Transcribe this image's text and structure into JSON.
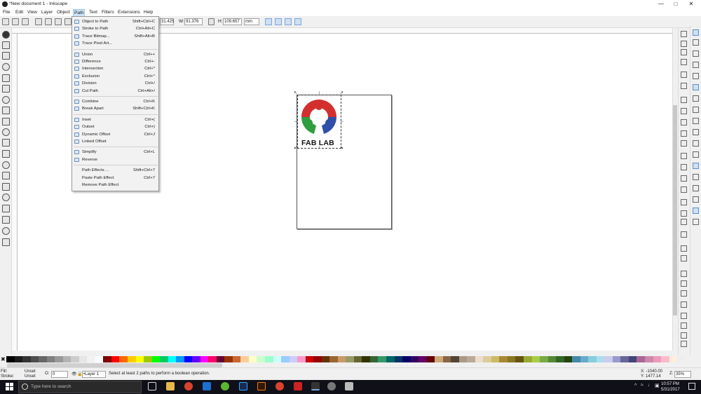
{
  "window": {
    "title": "*New document 1 - Inkscape"
  },
  "menubar": [
    "File",
    "Edit",
    "View",
    "Layer",
    "Object",
    "Path",
    "Text",
    "Filters",
    "Extensions",
    "Help"
  ],
  "toolbar": {
    "x_value": "31.425",
    "w_label": "W:",
    "w_value": "91.376",
    "h_label": "H:",
    "h_value": "109.657",
    "unit": "mm"
  },
  "path_menu": [
    {
      "label": "Object to Path",
      "shortcut": "Shift+Ctrl+C",
      "icon": true
    },
    {
      "label": "Stroke to Path",
      "shortcut": "Ctrl+Alt+C",
      "icon": true
    },
    {
      "label": "Trace Bitmap...",
      "shortcut": "Shift+Alt+B",
      "icon": true
    },
    {
      "label": "Trace Pixel Art...",
      "shortcut": "",
      "icon": true
    },
    {
      "sep": true
    },
    {
      "label": "Union",
      "shortcut": "Ctrl++",
      "icon": true
    },
    {
      "label": "Difference",
      "shortcut": "Ctrl+-",
      "icon": true
    },
    {
      "label": "Intersection",
      "shortcut": "Ctrl+*",
      "icon": true
    },
    {
      "label": "Exclusion",
      "shortcut": "Ctrl+^",
      "icon": true
    },
    {
      "label": "Division",
      "shortcut": "Ctrl+/",
      "icon": true
    },
    {
      "label": "Cut Path",
      "shortcut": "Ctrl+Alt+/",
      "icon": true
    },
    {
      "sep": true
    },
    {
      "label": "Combine",
      "shortcut": "Ctrl+K",
      "icon": true
    },
    {
      "label": "Break Apart",
      "shortcut": "Shift+Ctrl+K",
      "icon": true
    },
    {
      "sep": true
    },
    {
      "label": "Inset",
      "shortcut": "Ctrl+(",
      "icon": true
    },
    {
      "label": "Outset",
      "shortcut": "Ctrl+)",
      "icon": true
    },
    {
      "label": "Dynamic Offset",
      "shortcut": "Ctrl+J",
      "icon": true
    },
    {
      "label": "Linked Offset",
      "shortcut": "",
      "icon": true
    },
    {
      "sep": true
    },
    {
      "label": "Simplify",
      "shortcut": "Ctrl+L",
      "icon": true
    },
    {
      "label": "Reverse",
      "shortcut": "",
      "icon": true
    },
    {
      "sep": true
    },
    {
      "label": "Path Effects ...",
      "shortcut": "Shift+Ctrl+7",
      "icon": false
    },
    {
      "label": "Paste Path Effect",
      "shortcut": "Ctrl+7",
      "icon": false
    },
    {
      "label": "Remove Path Effect",
      "shortcut": "",
      "icon": false
    }
  ],
  "canvas": {
    "logo_text": "FAB LAB"
  },
  "status": {
    "fill_label": "Fill:",
    "fill_value": "Unset",
    "stroke_label": "Stroke:",
    "stroke_value": "Unset",
    "opacity_label": "O:",
    "opacity_value": "0",
    "layer": "•Layer 1",
    "message": "Select at least 2 paths to perform a boolean operation.",
    "x_coord": "X: -1040.00",
    "y_coord": "Y:  1477.14",
    "zoom_label": "Z:",
    "zoom_value": "35%"
  },
  "taskbar": {
    "search_placeholder": "Type here to search",
    "time": "10:57 PM",
    "date": "5/31/2017"
  },
  "colors": {
    "accent": "#cce4f7",
    "page_border": "#555555",
    "logo_red": "#d32f2f",
    "logo_green": "#2e9e3e",
    "logo_blue": "#2f4fa8"
  }
}
